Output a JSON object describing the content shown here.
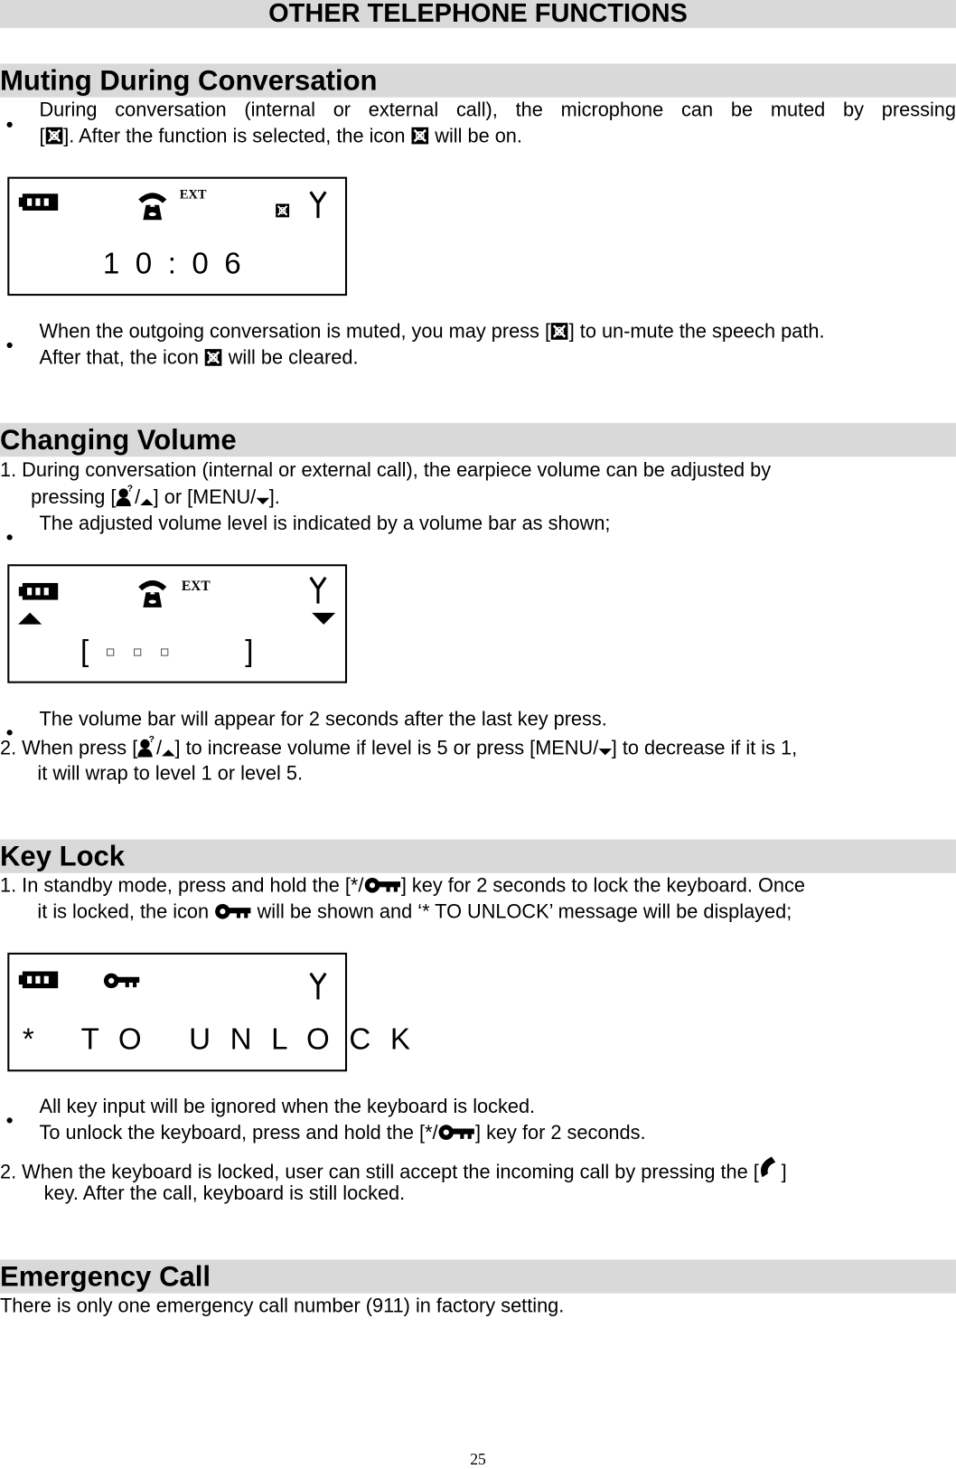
{
  "page_title": "OTHER TELEPHONE FUNCTIONS",
  "sections": {
    "muting": {
      "heading": "Muting During Conversation",
      "b1a": "During conversation (internal or external call), the microphone can be muted by pressing",
      "b1b_pre": "[",
      "b1b_mid": "].  After the function is selected, the icon ",
      "b1b_post": " will be on.",
      "lcd": {
        "label": "EXT",
        "time": "1 0 : 0 6"
      },
      "b2a_pre": "When the outgoing conversation is muted, you may press [",
      "b2a_post": "] to un-mute the speech path.",
      "b2b_pre": "After that, the icon ",
      "b2b_post": " will be cleared."
    },
    "volume": {
      "heading": "Changing Volume",
      "l1": "1.  During conversation (internal or external call), the earpiece volume can be adjusted by",
      "l2_pre": "pressing [",
      "l2_mid": "] or [MENU/",
      "l2_post": "].",
      "b1": "The adjusted volume level is indicated by a volume bar as shown;",
      "lcd": {
        "label": "EXT",
        "open": "[",
        "close": "]",
        "level": 3,
        "max": 5
      },
      "b2": "The volume bar will appear for 2 seconds after the last key press.",
      "l3_pre": "2.   When press [",
      "l3_mid": "] to increase volume if level is 5 or press [MENU/",
      "l3_post": "] to decrease if it is 1,",
      "l4": "it will wrap to level 1 or level 5."
    },
    "keylock": {
      "heading": "Key Lock",
      "l1_pre": "1.   In standby mode, press and hold the [*/",
      "l1_post": "] key for 2 seconds to lock the keyboard.  Once",
      "l2_pre": "it is locked, the icon ",
      "l2_post": " will be shown and ‘* TO UNLOCK’ message will be displayed;",
      "lcd": {
        "message": "*   T O   U N L O C K"
      },
      "b1": "All key input will be ignored when the keyboard is locked.",
      "b1b_pre": "To unlock the keyboard, press and hold the [*/",
      "b1b_post": "] key for 2 seconds.",
      "l3_pre": "2.    When the keyboard is locked, user can still accept the incoming call by pressing the [",
      "l3_post": "]",
      "l4": "key. After the call, keyboard is still locked."
    },
    "emergency": {
      "heading": "Emergency Call",
      "text": "There is only one emergency call number (911) in factory setting."
    }
  },
  "page_number": "25"
}
